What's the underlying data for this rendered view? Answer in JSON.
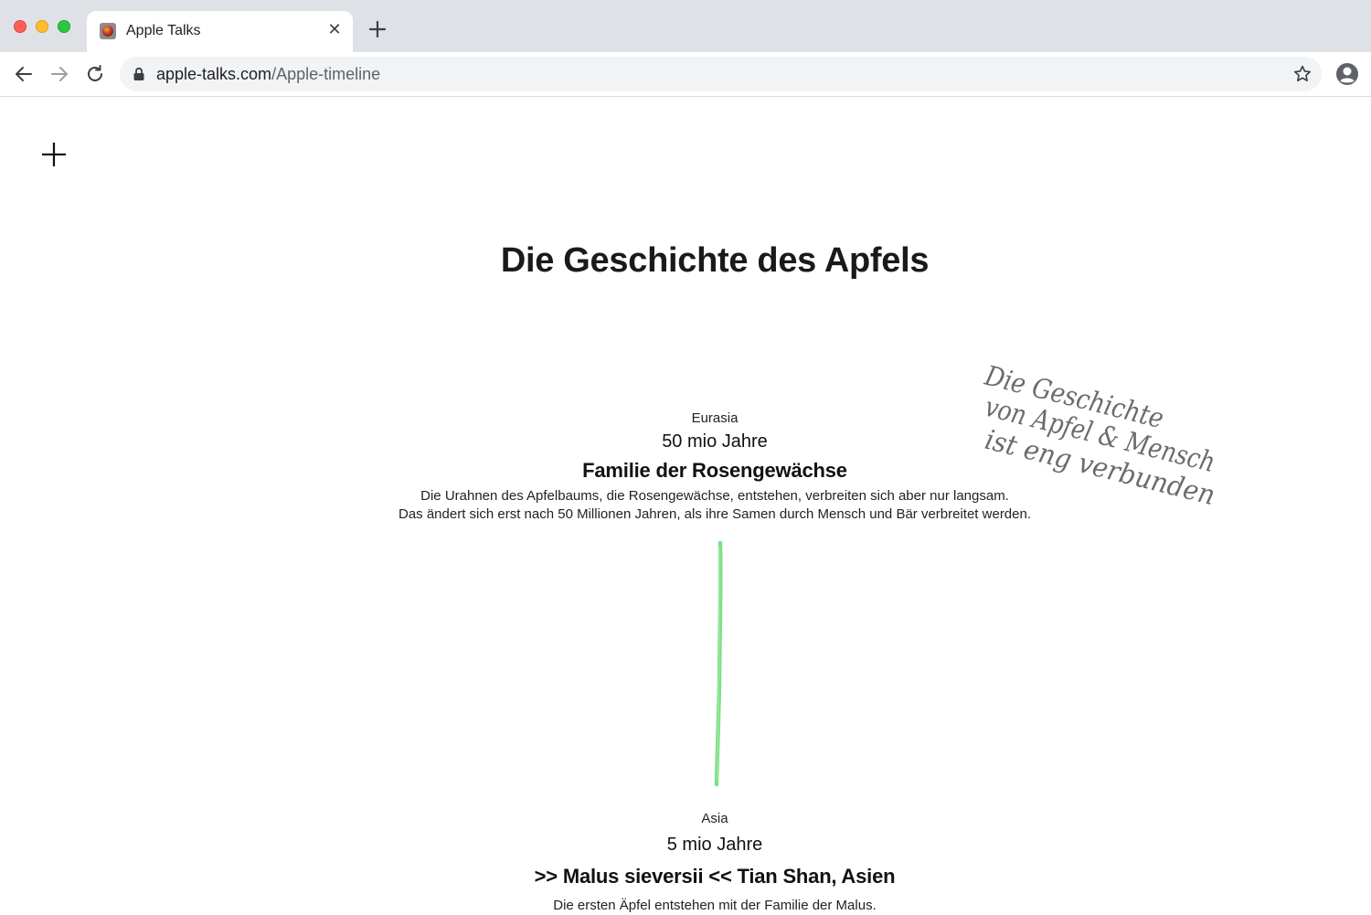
{
  "browser": {
    "tab": {
      "title": "Apple Talks",
      "close_glyph": "✕"
    },
    "address": {
      "domain": "apple-talks.com",
      "path": "/Apple-timeline"
    },
    "icons": [
      "back-arrow-icon",
      "forward-arrow-icon",
      "reload-icon",
      "lock-icon",
      "star-icon",
      "profile-icon",
      "new-tab-icon"
    ]
  },
  "page": {
    "title": "Die Geschichte des Apfels",
    "handwritten_note": [
      "Die Geschichte",
      "von Apfel & Mensch",
      "ist eng verbunden"
    ],
    "timeline": [
      {
        "region": "Eurasia",
        "years": "50 mio Jahre",
        "headline": "Familie der Rosengewächse",
        "description": [
          "Die Urahnen des Apfelbaums, die Rosengewächse, entstehen, verbreiten sich aber nur langsam.",
          "Das ändert sich erst nach 50 Millionen Jahren, als ihre Samen durch Mensch und Bär verbreitet werden."
        ]
      },
      {
        "region": "Asia",
        "years": "5 mio Jahre",
        "headline": ">> Malus sieversii << Tian Shan, Asien",
        "description": [
          "Die ersten Äpfel entstehen mit der Familie der Malus."
        ]
      }
    ],
    "colors": {
      "timeline_line": "#6fdc78",
      "text": "#1a1a1a",
      "handwriting": "#6b6b6b"
    }
  }
}
